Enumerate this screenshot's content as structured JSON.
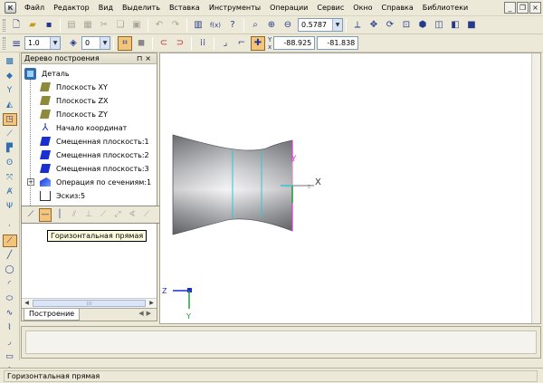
{
  "menu": {
    "items": [
      "Файл",
      "Редактор",
      "Вид",
      "Выделить",
      "Вставка",
      "Инструменты",
      "Операции",
      "Сервис",
      "Окно",
      "Справка",
      "Библиотеки"
    ]
  },
  "toolbar1": {
    "zoom_value": "0.5787",
    "fx_label": "f(x)"
  },
  "toolbar2": {
    "line_width_value": "1.0",
    "layer_value": "0",
    "coord_x": "-88.925",
    "coord_y": "-81.838"
  },
  "tree": {
    "title": "Дерево построения",
    "root": "Деталь",
    "items": [
      "Плоскость XY",
      "Плоскость ZX",
      "Плоскость ZY",
      "Начало координат",
      "Смещенная плоскость:1",
      "Смещенная плоскость:2",
      "Смещенная плоскость:3",
      "Операция по сечениям:1",
      "Эскиз:5"
    ],
    "tab_label": "Построение"
  },
  "tooltip": "Горизонтальная прямая",
  "canvas": {
    "axis_x_label": "X",
    "axis_y_label": "Y",
    "axis_z_label": "Z",
    "triad_z_label": "Z",
    "triad_y_label": "Y"
  },
  "status": {
    "text": "Горизонтальная прямая"
  },
  "colors": {
    "accent_active": "#f3c47a",
    "plane_olive": "#8d8a3b",
    "plane_blue": "#1a2fd0",
    "shape_gray": "#9a9a9e",
    "sketch_cyan": "#32c8d2",
    "sketch_magenta": "#d23cc8"
  }
}
